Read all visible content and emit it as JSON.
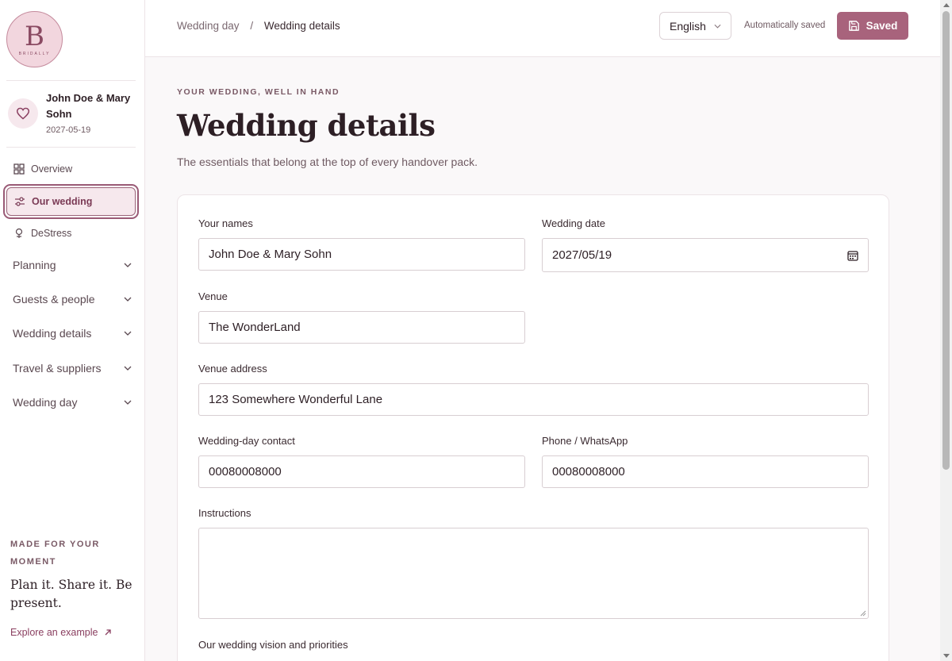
{
  "brand": {
    "logo_letter": "B",
    "logo_text": "BRIDALLY"
  },
  "couple": {
    "names": "John Doe & Mary Sohn",
    "date": "2027-05-19"
  },
  "nav": {
    "overview": "Overview",
    "our_wedding": "Our wedding",
    "destress": "DeStress",
    "groups": [
      "Planning",
      "Guests & people",
      "Wedding details",
      "Travel & suppliers",
      "Wedding day"
    ]
  },
  "sidebar_footer": {
    "kicker": "MADE FOR YOUR MOMENT",
    "tagline": "Plan it. Share it. Be present.",
    "explore": "Explore an example"
  },
  "topbar": {
    "breadcrumb_parent": "Wedding day",
    "breadcrumb_sep": "/",
    "breadcrumb_current": "Wedding details",
    "language": "English",
    "autosave": "Automatically saved",
    "saved": "Saved"
  },
  "page": {
    "kicker": "YOUR WEDDING, WELL IN HAND",
    "title": "Wedding details",
    "subtitle": "The essentials that belong at the top of every handover pack."
  },
  "form": {
    "names_label": "Your names",
    "names_value": "John Doe & Mary Sohn",
    "date_label": "Wedding date",
    "date_value": "2027/05/19",
    "venue_label": "Venue",
    "venue_value": "The WonderLand",
    "address_label": "Venue address",
    "address_value": "123 Somewhere Wonderful Lane",
    "contact_label": "Wedding-day contact",
    "contact_value": "00080008000",
    "phone_label": "Phone / WhatsApp",
    "phone_value": "00080008000",
    "instructions_label": "Instructions",
    "vision_label": "Our wedding vision and priorities"
  },
  "colors": {
    "accent": "#a8637c",
    "accent_dark": "#7a3a55",
    "active_bg": "#f6e8ed"
  }
}
